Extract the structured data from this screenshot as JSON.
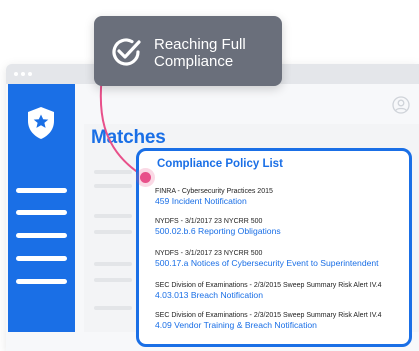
{
  "callout": {
    "line1": "Reaching Full",
    "line2": "Compliance",
    "icon": "check-badge-icon"
  },
  "main": {
    "heading": "Matches"
  },
  "card": {
    "title": "Compliance Policy List",
    "items": [
      {
        "source": "FINRA  - Cybersecurity Practices 2015",
        "link": "459 Incident Notification"
      },
      {
        "source": "NYDFS - 3/1/2017 23 NYCRR 500",
        "link": "500.02.b.6 Reporting Obligations"
      },
      {
        "source": "NYDFS - 3/1/2017 23 NYCRR 500",
        "link": "500.17.a Notices of Cybersecurity Event to Superintendent"
      },
      {
        "source": "SEC Division of Examinations - 2/3/2015 Sweep Summary Risk Alert IV.4",
        "link": "4.03.013 Breach Notification"
      },
      {
        "source": "SEC Division of Examinations - 2/3/2015 Sweep Summary Risk Alert IV.4",
        "link": "4.09 Vendor Training & Breach Notification"
      }
    ]
  },
  "colors": {
    "accent": "#1a6fe6",
    "callout_bg": "#6a6f7b",
    "connector": "#e8508a"
  },
  "icons": {
    "sidebar_logo": "shield-star-icon",
    "user": "user-avatar-icon"
  }
}
